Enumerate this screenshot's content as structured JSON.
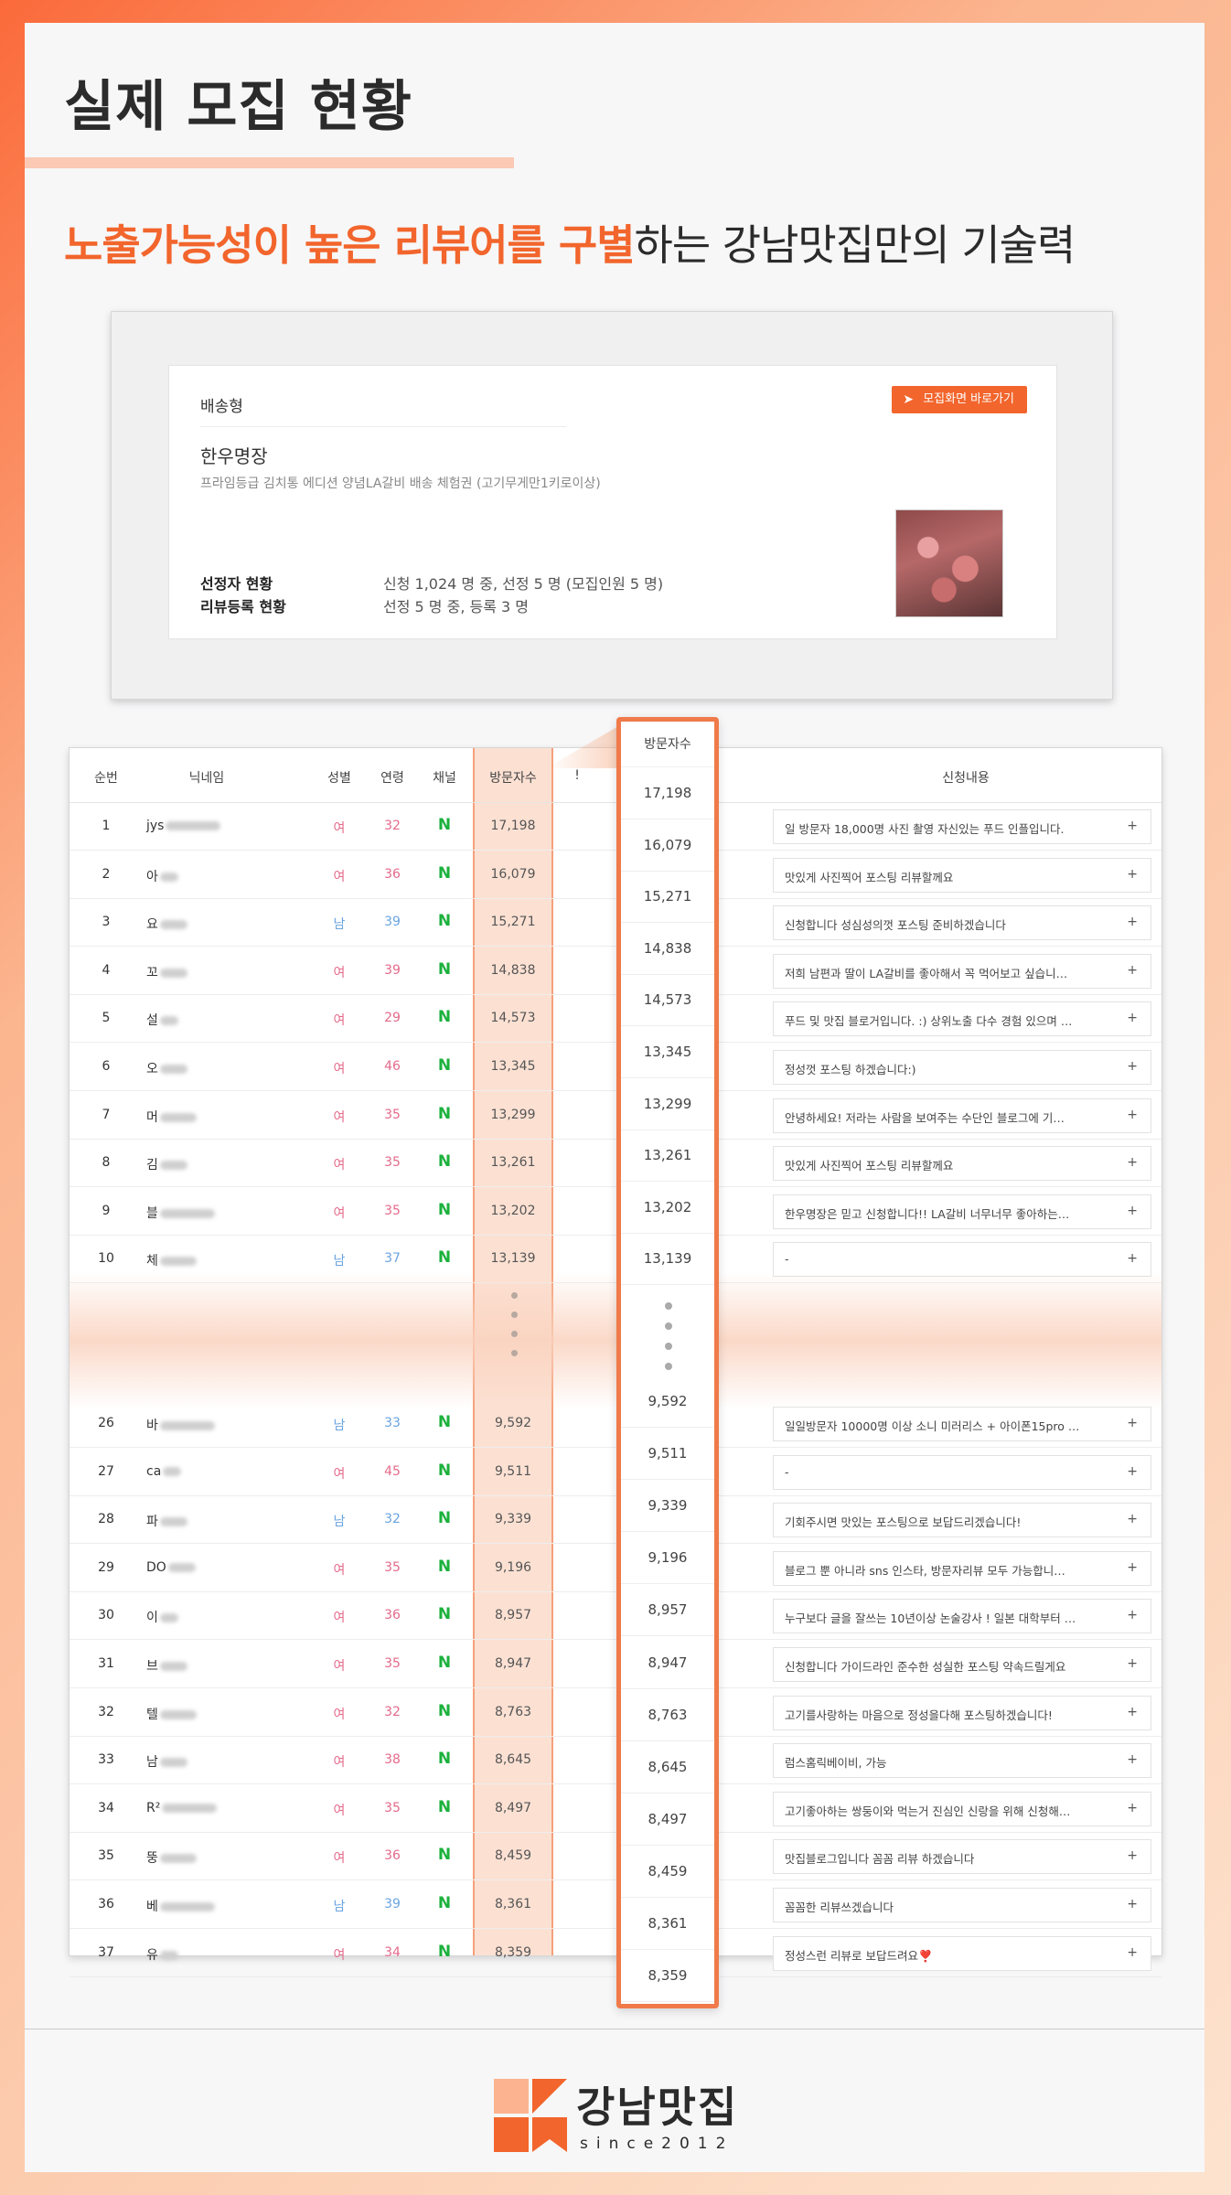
{
  "header": {
    "title": "실제 모집 현황",
    "subtitle_highlight_1": "노출가능성이 높은 리뷰어를 구별",
    "subtitle_rest": "하는 강남맛집만의 기술력"
  },
  "campaign_card": {
    "type": "배송형",
    "button_label": "모집화면 바로가기",
    "name": "한우명장",
    "description": "프라임등급 김치통 에디션 양념LA갈비 배송 체험권 (고기무게만1키로이상)",
    "selected_label": "선정자 현황",
    "selected_value": "신청 1,024 명 중, 선정 5 명 (모집인원 5 명)",
    "review_label": "리뷰등록 현황",
    "review_value": "선정 5 명 중, 등록 3 명"
  },
  "table": {
    "headers": {
      "rank": "순번",
      "nickname": "닉네임",
      "gender": "성별",
      "age": "연령",
      "channel": "채널",
      "visits": "방문자수",
      "extra": "!",
      "application": "신청내용"
    },
    "rows_top": [
      {
        "rank": "1",
        "nick": "jys",
        "gender": "여",
        "age": "32",
        "ch": "N",
        "visits": "17,198",
        "apply": "일 방문자 18,000명 사진 촬영 자신있는 푸드 인플입니다."
      },
      {
        "rank": "2",
        "nick": "아",
        "gender": "여",
        "age": "36",
        "ch": "N",
        "visits": "16,079",
        "apply": "맛있게 사진찍어 포스팅 리뷰할께요"
      },
      {
        "rank": "3",
        "nick": "요",
        "gender": "남",
        "age": "39",
        "ch": "N",
        "visits": "15,271",
        "apply": "신청합니다 성심성의껏 포스팅 준비하겠습니다"
      },
      {
        "rank": "4",
        "nick": "꼬",
        "gender": "여",
        "age": "39",
        "ch": "N",
        "visits": "14,838",
        "apply": "저희 남편과 딸이 LA갈비를 좋아해서 꼭 먹어보고 싶습니…"
      },
      {
        "rank": "5",
        "nick": "설",
        "gender": "여",
        "age": "29",
        "ch": "N",
        "visits": "14,573",
        "apply": "푸드 및 맛집 블로거입니다. :) 상위노출 다수 경험 있으며 …"
      },
      {
        "rank": "6",
        "nick": "오",
        "gender": "여",
        "age": "46",
        "ch": "N",
        "visits": "13,345",
        "apply": "정성껏 포스팅 하겠습니다:)"
      },
      {
        "rank": "7",
        "nick": "머",
        "gender": "여",
        "age": "35",
        "ch": "N",
        "visits": "13,299",
        "apply": "안녕하세요! 저라는 사람을 보여주는 수단인 블로그에 기…"
      },
      {
        "rank": "8",
        "nick": "김",
        "gender": "여",
        "age": "35",
        "ch": "N",
        "visits": "13,261",
        "apply": "맛있게 사진찍어 포스팅 리뷰할께요"
      },
      {
        "rank": "9",
        "nick": "블",
        "gender": "여",
        "age": "35",
        "ch": "N",
        "visits": "13,202",
        "apply": "한우명장은 믿고 신청합니다!! LA갈비 너무너무 좋아하는…"
      },
      {
        "rank": "10",
        "nick": "체",
        "gender": "남",
        "age": "37",
        "ch": "N",
        "visits": "13,139",
        "apply": "-"
      }
    ],
    "rows_bottom": [
      {
        "rank": "26",
        "nick": "바",
        "gender": "남",
        "age": "33",
        "ch": "N",
        "visits": "9,592",
        "apply": "일일방문자 10000명 이상 소니 미러리스 + 아이폰15pro …"
      },
      {
        "rank": "27",
        "nick": "ca",
        "gender": "여",
        "age": "45",
        "ch": "N",
        "visits": "9,511",
        "apply": "-"
      },
      {
        "rank": "28",
        "nick": "파",
        "gender": "남",
        "age": "32",
        "ch": "N",
        "visits": "9,339",
        "apply": "기회주시면 맛있는 포스팅으로 보답드리겠습니다!"
      },
      {
        "rank": "29",
        "nick": "DO",
        "gender": "여",
        "age": "35",
        "ch": "N",
        "visits": "9,196",
        "apply": "블로그 뿐 아니라 sns 인스타, 방문자리뷰 모두 가능합니…"
      },
      {
        "rank": "30",
        "nick": "이",
        "gender": "여",
        "age": "36",
        "ch": "N",
        "visits": "8,957",
        "apply": "누구보다 글을 잘쓰는 10년이상 논술강사 ! 일본 대학부터 …"
      },
      {
        "rank": "31",
        "nick": "브",
        "gender": "여",
        "age": "35",
        "ch": "N",
        "visits": "8,947",
        "apply": "신청합니다 가이드라인 준수한 성실한 포스팅 약속드릴게요"
      },
      {
        "rank": "32",
        "nick": "텔",
        "gender": "여",
        "age": "32",
        "ch": "N",
        "visits": "8,763",
        "apply": "고기를사랑하는 마음으로 정성을다해 포스팅하겠습니다!"
      },
      {
        "rank": "33",
        "nick": "남",
        "gender": "여",
        "age": "38",
        "ch": "N",
        "visits": "8,645",
        "apply": "럼스홈릭베이비, 가능"
      },
      {
        "rank": "34",
        "nick": "R²",
        "gender": "여",
        "age": "35",
        "ch": "N",
        "visits": "8,497",
        "apply": "고기좋아하는 쌍둥이와 먹는거 진심인 신랑을 위해 신청해…"
      },
      {
        "rank": "35",
        "nick": "뚱",
        "gender": "여",
        "age": "36",
        "ch": "N",
        "visits": "8,459",
        "apply": "맛집블로그입니다 꼼꼼 리뷰 하겠습니다"
      },
      {
        "rank": "36",
        "nick": "베",
        "gender": "남",
        "age": "39",
        "ch": "N",
        "visits": "8,361",
        "apply": "꼼꼼한 리뷰쓰겠습니다"
      },
      {
        "rank": "37",
        "nick": "유",
        "gender": "여",
        "age": "34",
        "ch": "N",
        "visits": "8,359",
        "apply": "정성스런 리뷰로 보답드려요❣️"
      }
    ],
    "plus": "+"
  },
  "zoom": {
    "header": "방문자수",
    "values_top": [
      "17,198",
      "16,079",
      "15,271",
      "14,838",
      "14,573",
      "13,345",
      "13,299",
      "13,261",
      "13,202",
      "13,139"
    ],
    "values_bottom": [
      "9,592",
      "9,511",
      "9,339",
      "9,196",
      "8,957",
      "8,947",
      "8,763",
      "8,645",
      "8,497",
      "8,459",
      "8,361",
      "8,359"
    ]
  },
  "footer": {
    "logo_text": "강남맛집",
    "logo_sub": "since2012"
  },
  "colors": {
    "accent": "#f2652c",
    "female": "#e56a8a",
    "male": "#6aa4e0",
    "naver": "#1bb13c"
  }
}
